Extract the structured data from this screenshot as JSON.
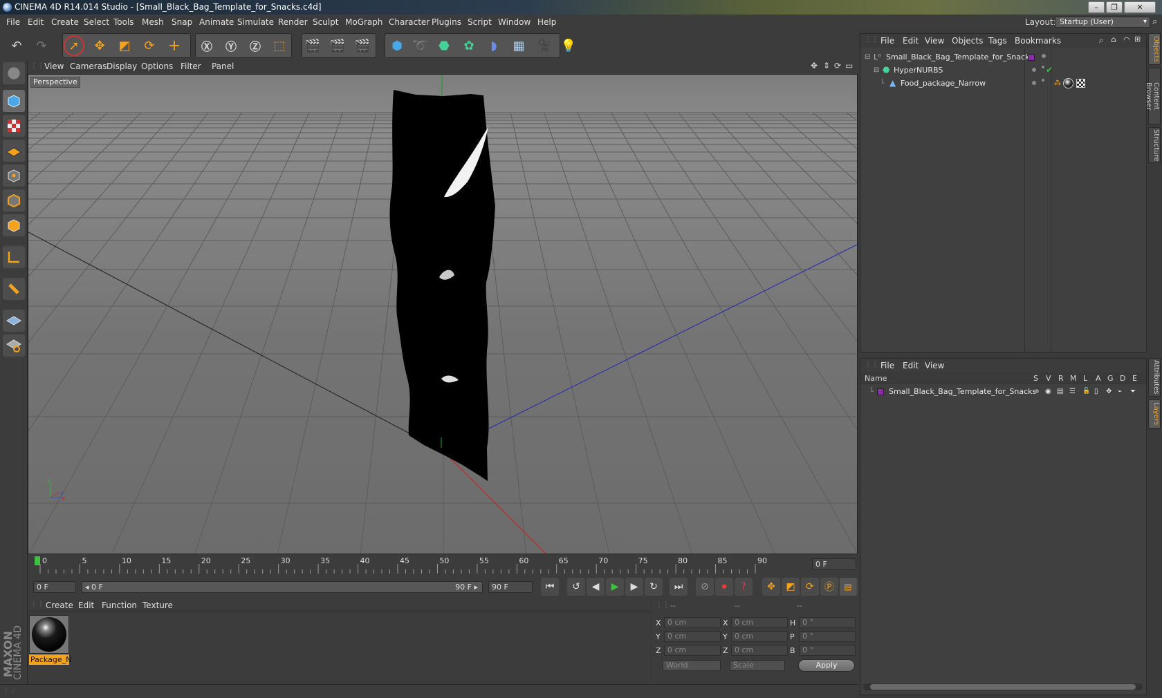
{
  "title": "CINEMA 4D R14.014 Studio - [Small_Black_Bag_Template_for_Snacks.c4d]",
  "menu": [
    "File",
    "Edit",
    "Create",
    "Select",
    "Tools",
    "Mesh",
    "Snap",
    "Animate",
    "Simulate",
    "Render",
    "Sculpt",
    "MoGraph",
    "Character",
    "Plugins",
    "Script",
    "Window",
    "Help"
  ],
  "layout": {
    "label": "Layout:",
    "value": "Startup (User)"
  },
  "viewport": {
    "menu": [
      "View",
      "Cameras",
      "Display",
      "Options",
      "Filter",
      "Panel"
    ],
    "camera_label": "Perspective"
  },
  "timeline": {
    "ticks": [
      "0",
      "5",
      "10",
      "15",
      "20",
      "25",
      "30",
      "35",
      "40",
      "45",
      "50",
      "55",
      "60",
      "65",
      "70",
      "75",
      "80",
      "85",
      "90"
    ],
    "current_frame": "0 F",
    "start_frame": "0 F",
    "range_start": "◂ 0 F",
    "range_end": "90 F ▸",
    "end_frame": "90 F"
  },
  "materials": {
    "menu": [
      "Create",
      "Edit",
      "Function",
      "Texture"
    ],
    "items": [
      {
        "name": "Package_N"
      }
    ]
  },
  "coordinates": {
    "headers": [
      "--",
      "--",
      "--"
    ],
    "rows": [
      {
        "a": "X",
        "pos": "0 cm",
        "b": "X",
        "size": "0 cm",
        "c": "H",
        "rot": "0 °"
      },
      {
        "a": "Y",
        "pos": "0 cm",
        "b": "Y",
        "size": "0 cm",
        "c": "P",
        "rot": "0 °"
      },
      {
        "a": "Z",
        "pos": "0 cm",
        "b": "Z",
        "size": "0 cm",
        "c": "B",
        "rot": "0 °"
      }
    ],
    "mode": "World",
    "scale_mode": "Scale",
    "apply": "Apply"
  },
  "brand": {
    "maxon": "MAXON",
    "product": "CINEMA 4D"
  },
  "objects": {
    "menu": [
      "File",
      "Edit",
      "View",
      "Objects",
      "Tags",
      "Bookmarks"
    ],
    "tree": [
      {
        "name": "Small_Black_Bag_Template_for_Snacks"
      },
      {
        "name": "HyperNURBS"
      },
      {
        "name": "Food_package_Narrow"
      }
    ]
  },
  "layers": {
    "menu": [
      "File",
      "Edit",
      "View"
    ],
    "name_header": "Name",
    "flag_headers": [
      "S",
      "V",
      "R",
      "M",
      "L",
      "A",
      "G",
      "D",
      "E"
    ],
    "items": [
      {
        "name": "Small_Black_Bag_Template_for_Snacks",
        "color": "#8a2da8"
      }
    ]
  },
  "side_tabs": [
    "Objects",
    "Content Browser",
    "Structure",
    "Attributes",
    "Layers"
  ],
  "colors": {
    "accent": "#f5a21b",
    "layer": "#8a2da8",
    "play": "#3ec13e"
  }
}
